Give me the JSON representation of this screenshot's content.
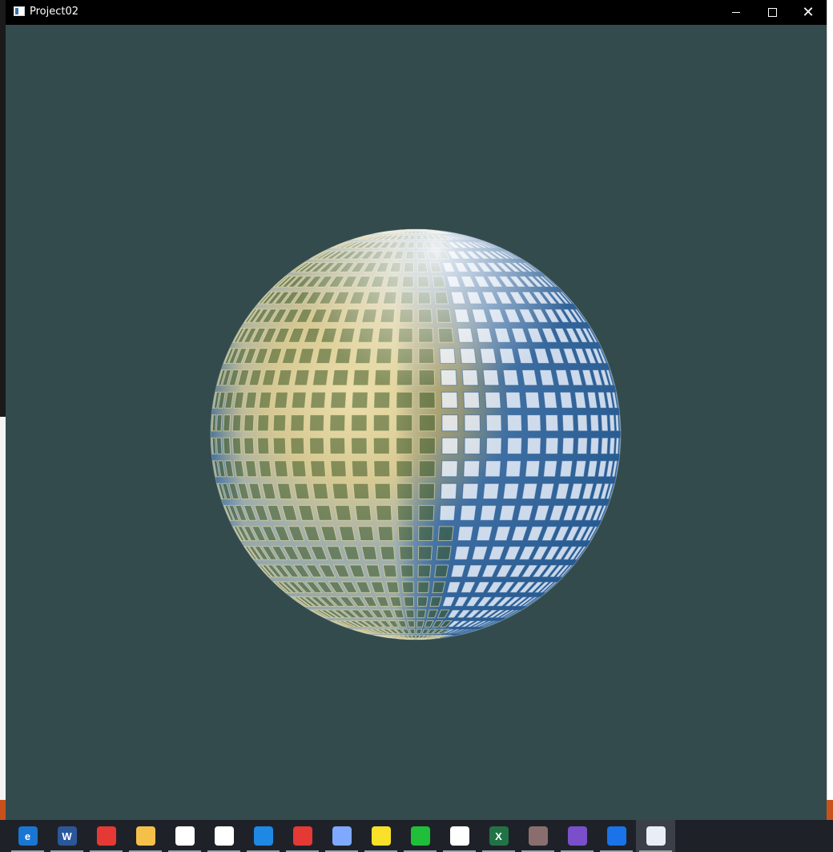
{
  "window": {
    "title": "Project02",
    "background_color": "#334b4c",
    "controls": [
      "minimize-icon",
      "maximize-icon",
      "close-icon"
    ]
  },
  "scene": {
    "object": "textured sphere",
    "colors": {
      "blue": "#2f66a3",
      "gold": "#d8c48a",
      "olive": "#6f7a2e",
      "highlight": "#f3f6fa"
    }
  },
  "taskbar": {
    "items": [
      {
        "name": "edge-icon",
        "glyph": "e",
        "color": "#1976d2"
      },
      {
        "name": "word-icon",
        "glyph": "W",
        "color": "#2b579a"
      },
      {
        "name": "chrome-icon",
        "glyph": "",
        "color": "#e53935"
      },
      {
        "name": "file-explorer-icon",
        "glyph": "",
        "color": "#f5c04a"
      },
      {
        "name": "store-icon",
        "glyph": "",
        "color": "#ffffff"
      },
      {
        "name": "mail-icon",
        "glyph": "",
        "color": "#ffffff"
      },
      {
        "name": "browser-icon",
        "glyph": "",
        "color": "#1e88e5"
      },
      {
        "name": "security-icon",
        "glyph": "",
        "color": "#e53935"
      },
      {
        "name": "feishu-icon",
        "glyph": "",
        "color": "#7ea9ff"
      },
      {
        "name": "sticky-notes-icon",
        "glyph": "",
        "color": "#f9e12a"
      },
      {
        "name": "iqiyi-icon",
        "glyph": "",
        "color": "#1fbf3a"
      },
      {
        "name": "wechat-icon",
        "glyph": "",
        "color": "#ffffff"
      },
      {
        "name": "excel-icon",
        "glyph": "X",
        "color": "#217346"
      },
      {
        "name": "avatar-icon",
        "glyph": "",
        "color": "#8a6e6e"
      },
      {
        "name": "visual-studio-icon",
        "glyph": "",
        "color": "#7b4fc9"
      },
      {
        "name": "maps-icon",
        "glyph": "",
        "color": "#1a73e8"
      },
      {
        "name": "project02-app-icon",
        "glyph": "",
        "color": "#e8eef3",
        "active": true
      }
    ]
  }
}
